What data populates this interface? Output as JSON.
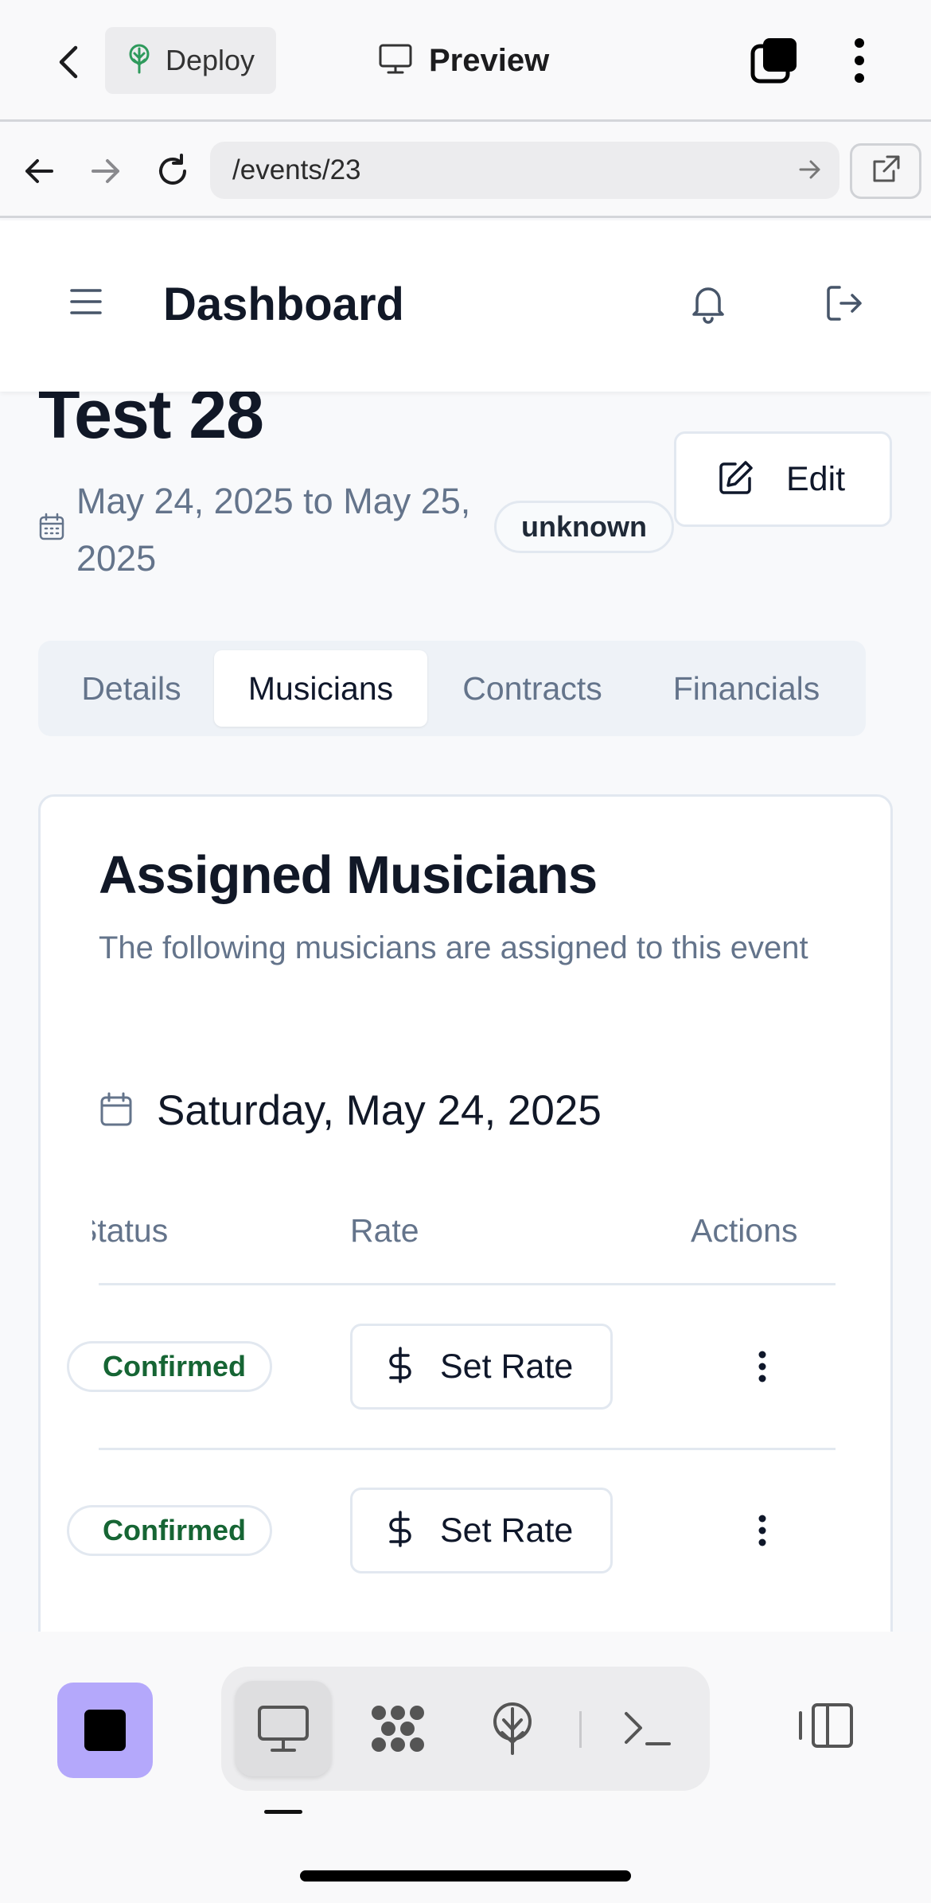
{
  "appbar": {
    "deploy_label": "Deploy",
    "preview_label": "Preview"
  },
  "browser": {
    "url": "/events/23"
  },
  "header": {
    "title": "Dashboard"
  },
  "event": {
    "title": "Test 28",
    "date_range": "May 24, 2025 to May 25, 2025",
    "status": "unknown",
    "edit_label": "Edit"
  },
  "tabs": [
    {
      "label": "Details",
      "active": false
    },
    {
      "label": "Musicians",
      "active": true
    },
    {
      "label": "Contracts",
      "active": false
    },
    {
      "label": "Financials",
      "active": false
    }
  ],
  "card": {
    "title": "Assigned Musicians",
    "description": "The following musicians are assigned to this event",
    "day_label": "Saturday, May 24, 2025"
  },
  "table": {
    "headers": {
      "status": "Status",
      "rate": "Rate",
      "actions": "Actions"
    },
    "rows": [
      {
        "status": "Confirmed",
        "rate_button": "Set Rate"
      },
      {
        "status": "Confirmed",
        "rate_button": "Set Rate"
      }
    ]
  },
  "colors": {
    "accent_purple": "#b4a8fb",
    "confirmed_green": "#166534",
    "muted_text": "#64748b",
    "border": "#e2e8f0"
  },
  "icons": {
    "back": "chevron-left-icon",
    "deploy": "deploy-tree-icon",
    "preview": "monitor-icon",
    "tabs": "tabs-icon",
    "menu": "kebab-icon",
    "calendar": "calendar-icon",
    "edit": "edit-icon",
    "dollar": "dollar-icon",
    "bell": "bell-icon",
    "logout": "logout-icon"
  }
}
